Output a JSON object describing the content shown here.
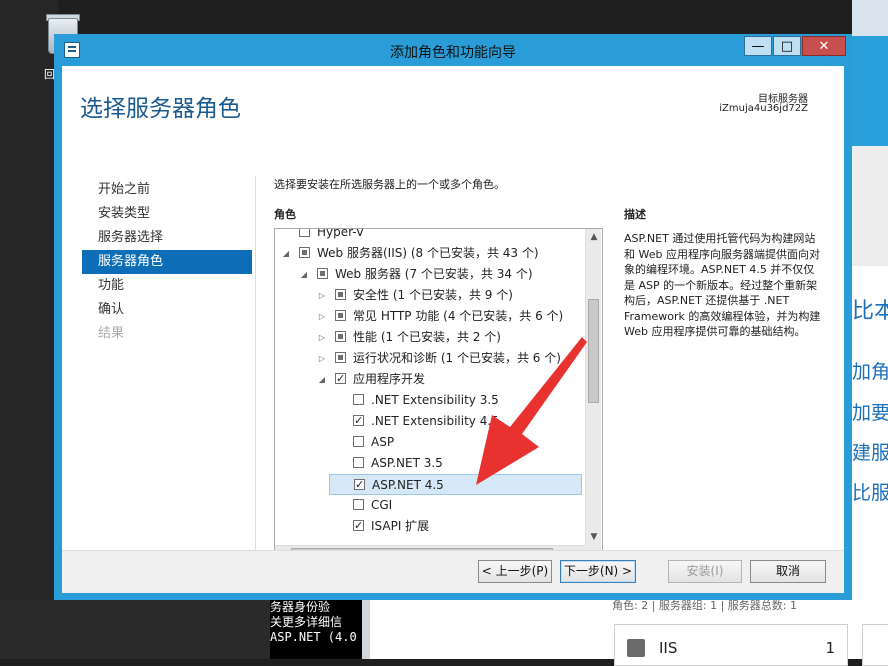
{
  "desktop": {
    "recycle_label": "回",
    "side_fragments": [
      "比本",
      "加角色",
      "加要管",
      "建服务",
      "比服务"
    ],
    "console_lines": [
      "务器身份验",
      "关更多详细信",
      "ASP.NET (4.0"
    ],
    "role_count": "角色: 2 | 服务器组: 1 | 服务器总数: 1",
    "iis_card": {
      "name": "IIS",
      "count": "1"
    }
  },
  "window": {
    "title": "添加角色和功能向导",
    "controls": {
      "minimize": "—",
      "maximize": "□",
      "close": "✕"
    }
  },
  "page": {
    "title": "选择服务器角色",
    "destination_label": "目标服务器",
    "destination_server": "iZmuja4u36jd72Z"
  },
  "nav": {
    "items": [
      {
        "label": "开始之前",
        "state": "normal"
      },
      {
        "label": "安装类型",
        "state": "normal"
      },
      {
        "label": "服务器选择",
        "state": "normal"
      },
      {
        "label": "服务器角色",
        "state": "active"
      },
      {
        "label": "功能",
        "state": "normal"
      },
      {
        "label": "确认",
        "state": "normal"
      },
      {
        "label": "结果",
        "state": "disabled"
      }
    ]
  },
  "content": {
    "instruction": "选择要安装在所选服务器上的一个或多个角色。",
    "roles_header": "角色",
    "description_header": "描述",
    "description": "ASP.NET 通过使用托管代码为构建网站和 Web 应用程序向服务器端提供面向对象的编程环境。ASP.NET 4.5 并不仅仅是 ASP 的一个新版本。经过整个重新架构后，ASP.NET 还提供基于 .NET Framework 的高效编程体验，并为构建 Web 应用程序提供可靠的基础结构。",
    "tree": [
      {
        "label": "Hyper-V",
        "level": 0,
        "toggle": "",
        "check": "none"
      },
      {
        "label": "Web 服务器(IIS) (8 个已安装，共 43 个)",
        "level": 0,
        "toggle": "◢",
        "check": "partial"
      },
      {
        "label": "Web 服务器 (7 个已安装，共 34 个)",
        "level": 1,
        "toggle": "◢",
        "check": "partial"
      },
      {
        "label": "安全性 (1 个已安装，共 9 个)",
        "level": 2,
        "toggle": "▷",
        "check": "partial"
      },
      {
        "label": "常见 HTTP 功能 (4 个已安装，共 6 个)",
        "level": 2,
        "toggle": "▷",
        "check": "partial"
      },
      {
        "label": "性能 (1 个已安装，共 2 个)",
        "level": 2,
        "toggle": "▷",
        "check": "partial"
      },
      {
        "label": "运行状况和诊断 (1 个已安装，共 6 个)",
        "level": 2,
        "toggle": "▷",
        "check": "partial"
      },
      {
        "label": "应用程序开发",
        "level": 2,
        "toggle": "◢",
        "check": "checked"
      },
      {
        "label": ".NET Extensibility 3.5",
        "level": 3,
        "toggle": "",
        "check": "none"
      },
      {
        "label": ".NET Extensibility 4.5",
        "level": 3,
        "toggle": "",
        "check": "checked"
      },
      {
        "label": "ASP",
        "level": 3,
        "toggle": "",
        "check": "none"
      },
      {
        "label": "ASP.NET 3.5",
        "level": 3,
        "toggle": "",
        "check": "none"
      },
      {
        "label": "ASP.NET 4.5",
        "level": 3,
        "toggle": "",
        "check": "checked",
        "selected": true
      },
      {
        "label": "CGI",
        "level": 3,
        "toggle": "",
        "check": "none"
      },
      {
        "label": "ISAPI 扩展",
        "level": 3,
        "toggle": "",
        "check": "checked"
      }
    ]
  },
  "footer": {
    "prev": "< 上一步(P)",
    "next": "下一步(N) >",
    "install": "安装(I)",
    "cancel": "取消"
  },
  "colors": {
    "title_bar": "#2a9dd8",
    "nav_active": "#0e6db7",
    "page_title": "#1b5a8e",
    "arrow": "#e8322f"
  }
}
